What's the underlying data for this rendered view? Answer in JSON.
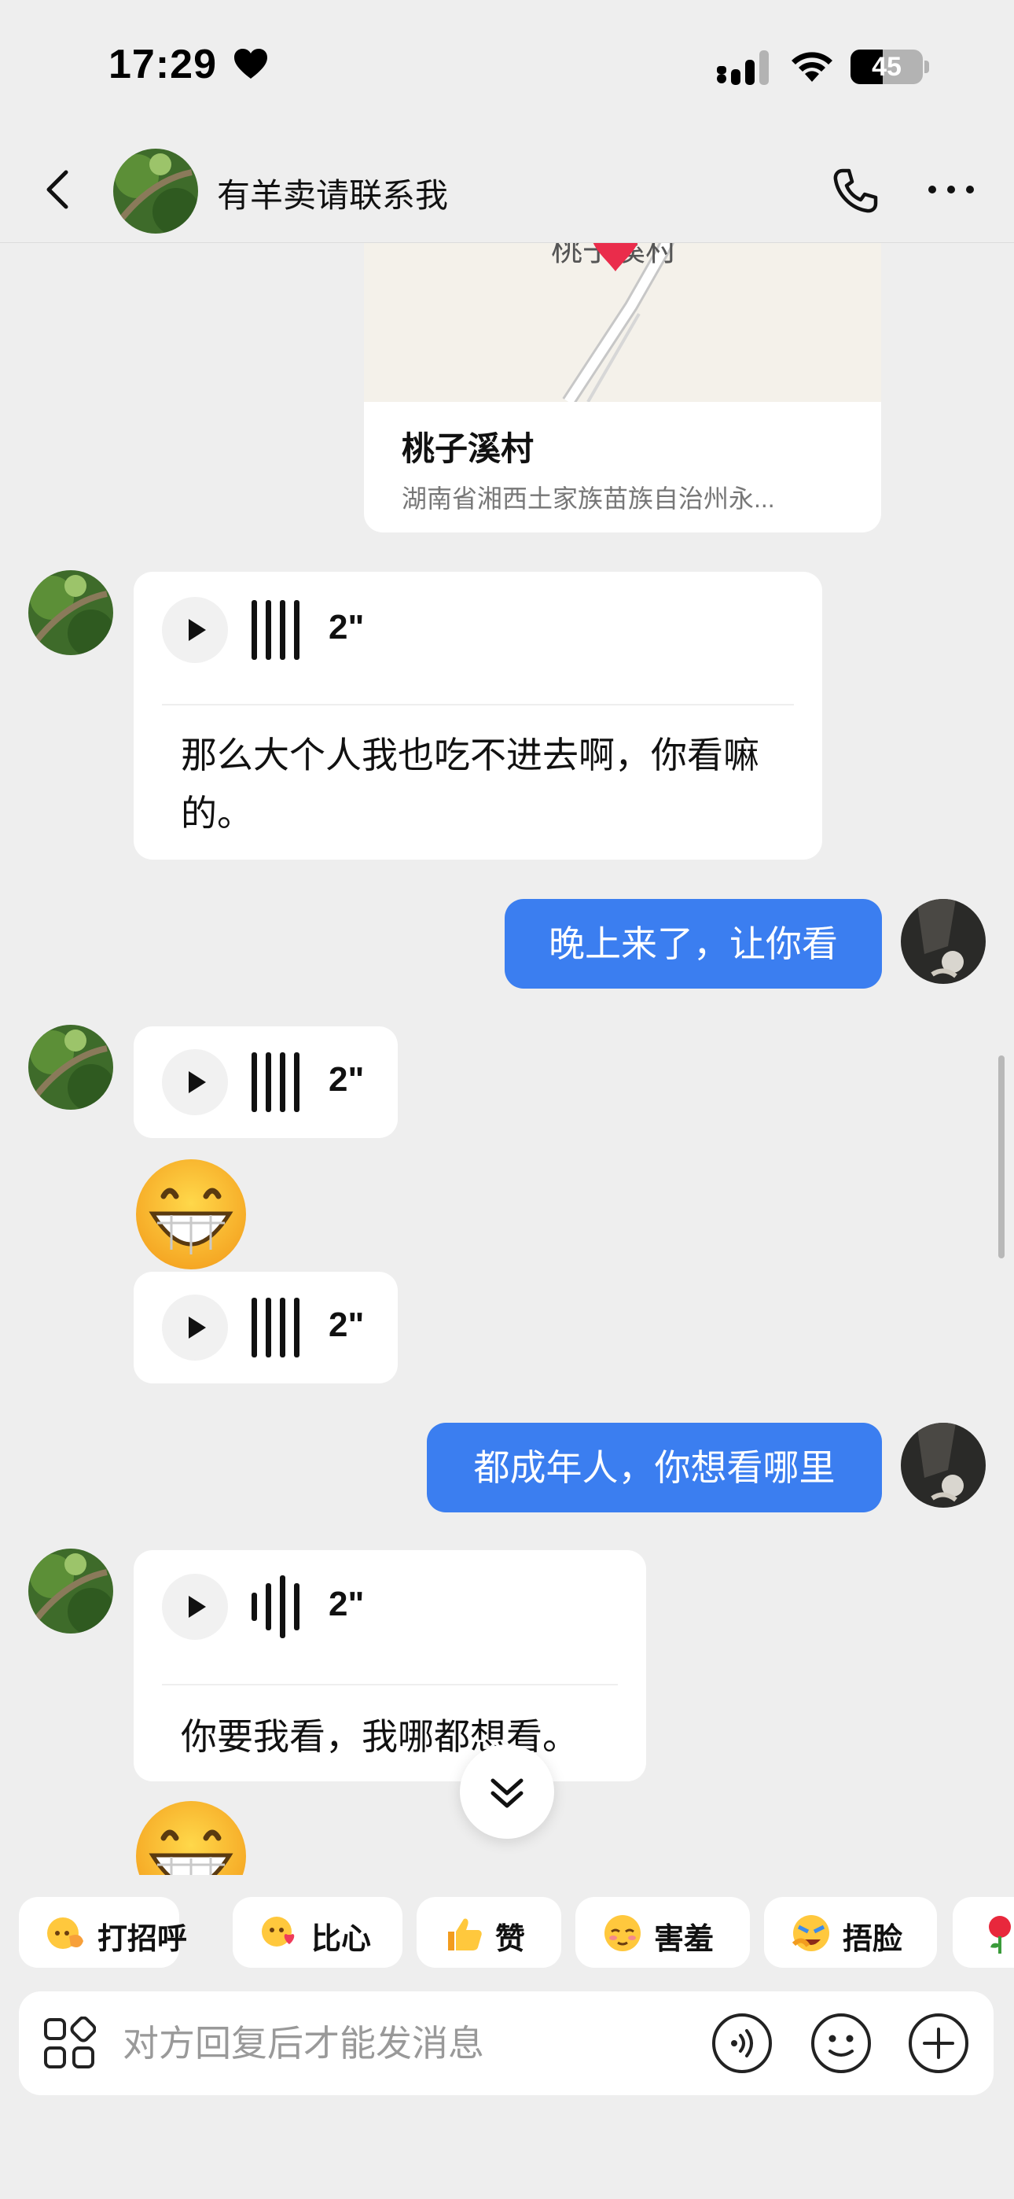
{
  "status_bar": {
    "time": "17:29",
    "battery": "45",
    "battery_level": 0.45
  },
  "header": {
    "title": "有羊卖请联系我",
    "back_icon": "chevron-left-icon",
    "call_icon": "phone-icon",
    "more_icon": "more-horizontal-icon"
  },
  "location": {
    "map_label": "桃子溪村",
    "name": "桃子溪村",
    "address": "湖南省湘西土家族苗族自治州永..."
  },
  "messages": {
    "m1": {
      "duration": "2\"",
      "transcript": "那么大个人我也吃不进去啊，你看嘛的。"
    },
    "m2": {
      "text": "晚上来了，让你看"
    },
    "m3": {
      "duration": "2\""
    },
    "m4": {
      "emoji": "grinning-face-emoji"
    },
    "m5": {
      "duration": "2\""
    },
    "m6": {
      "text": "都成年人，你想看哪里"
    },
    "m7": {
      "duration": "2\"",
      "transcript": "你要我看，我哪都想看。"
    },
    "m8": {
      "emoji": "grinning-face-emoji"
    }
  },
  "quick_replies": [
    {
      "label": "打招呼",
      "icon": "wave-hand-icon"
    },
    {
      "label": "比心",
      "icon": "finger-heart-icon"
    },
    {
      "label": "赞",
      "icon": "thumbs-up-icon"
    },
    {
      "label": "害羞",
      "icon": "shy-face-icon"
    },
    {
      "label": "捂脸",
      "icon": "facepalm-icon"
    },
    {
      "label": "",
      "icon": "rose-icon"
    }
  ],
  "input": {
    "placeholder": "对方回复后才能发消息"
  },
  "colors": {
    "background": "#eeeeee",
    "bubble_mine": "#3b7ef0",
    "bubble_theirs": "#ffffff",
    "map_pin": "#ea2c4b"
  }
}
